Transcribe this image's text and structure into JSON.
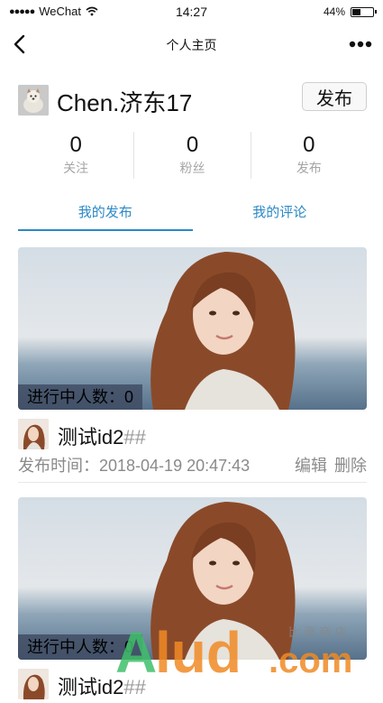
{
  "status_bar": {
    "carrier": "WeChat",
    "time": "14:27",
    "battery": "44%",
    "battery_level": 0.44
  },
  "navbar": {
    "title": "个人主页"
  },
  "profile": {
    "username": "Chen.济东17",
    "publish_label": "发布"
  },
  "stats": [
    {
      "value": "0",
      "label": "关注"
    },
    {
      "value": "0",
      "label": "粉丝"
    },
    {
      "value": "0",
      "label": "发布"
    }
  ],
  "tabs": [
    {
      "label": "我的发布",
      "active": true
    },
    {
      "label": "我的评论",
      "active": false
    }
  ],
  "posts": [
    {
      "badge": "进行中人数：0",
      "title": "测试id2",
      "tags": "##",
      "time": "发布时间：2018-04-19 20:47:43",
      "edit": "编辑",
      "delete": "删除"
    },
    {
      "badge": "进行中人数：0",
      "title": "测试id2",
      "tags": "##"
    }
  ],
  "watermark": {
    "brand": "Alud",
    "suffix": ".com",
    "cn": "比 源 商 店"
  },
  "colors": {
    "accent": "#2b89c6",
    "watermark_green": "#3fbf6a",
    "watermark_orange": "#f08a24"
  }
}
